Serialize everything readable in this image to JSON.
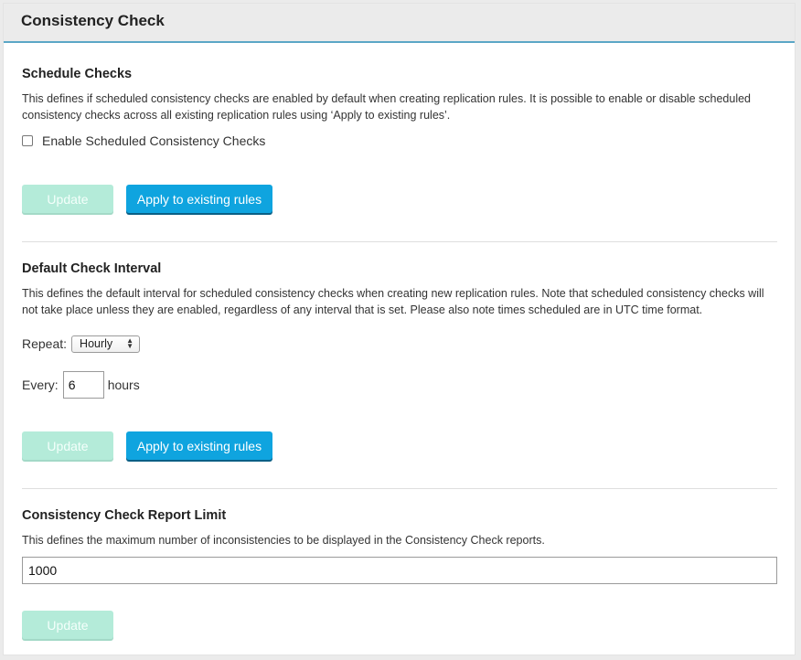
{
  "panel": {
    "title": "Consistency Check"
  },
  "schedule": {
    "title": "Schedule Checks",
    "description": "This defines if scheduled consistency checks are enabled by default when creating replication rules. It is possible to enable or disable scheduled consistency checks across all existing replication rules using ‘Apply to existing rules’.",
    "checkbox_label": "Enable Scheduled Consistency Checks",
    "checked": false,
    "update_label": "Update",
    "apply_label": "Apply to existing rules"
  },
  "interval": {
    "title": "Default Check Interval",
    "description": "This defines the default interval for scheduled consistency checks when creating new replication rules. Note that scheduled consistency checks will not take place unless they are enabled, regardless of any interval that is set. Please also note times scheduled are in UTC time format.",
    "repeat_label": "Repeat:",
    "repeat_value": "Hourly",
    "every_label": "Every:",
    "every_value": "6",
    "unit_label": "hours",
    "update_label": "Update",
    "apply_label": "Apply to existing rules"
  },
  "report": {
    "title": "Consistency Check Report Limit",
    "description": "This defines the maximum number of inconsistencies to be displayed in the Consistency Check reports.",
    "limit_value": "1000",
    "update_label": "Update"
  },
  "colors": {
    "header_border": "#5ba7c6",
    "primary_button": "#0fa4df",
    "disabled_button": "#b4ebd9"
  }
}
